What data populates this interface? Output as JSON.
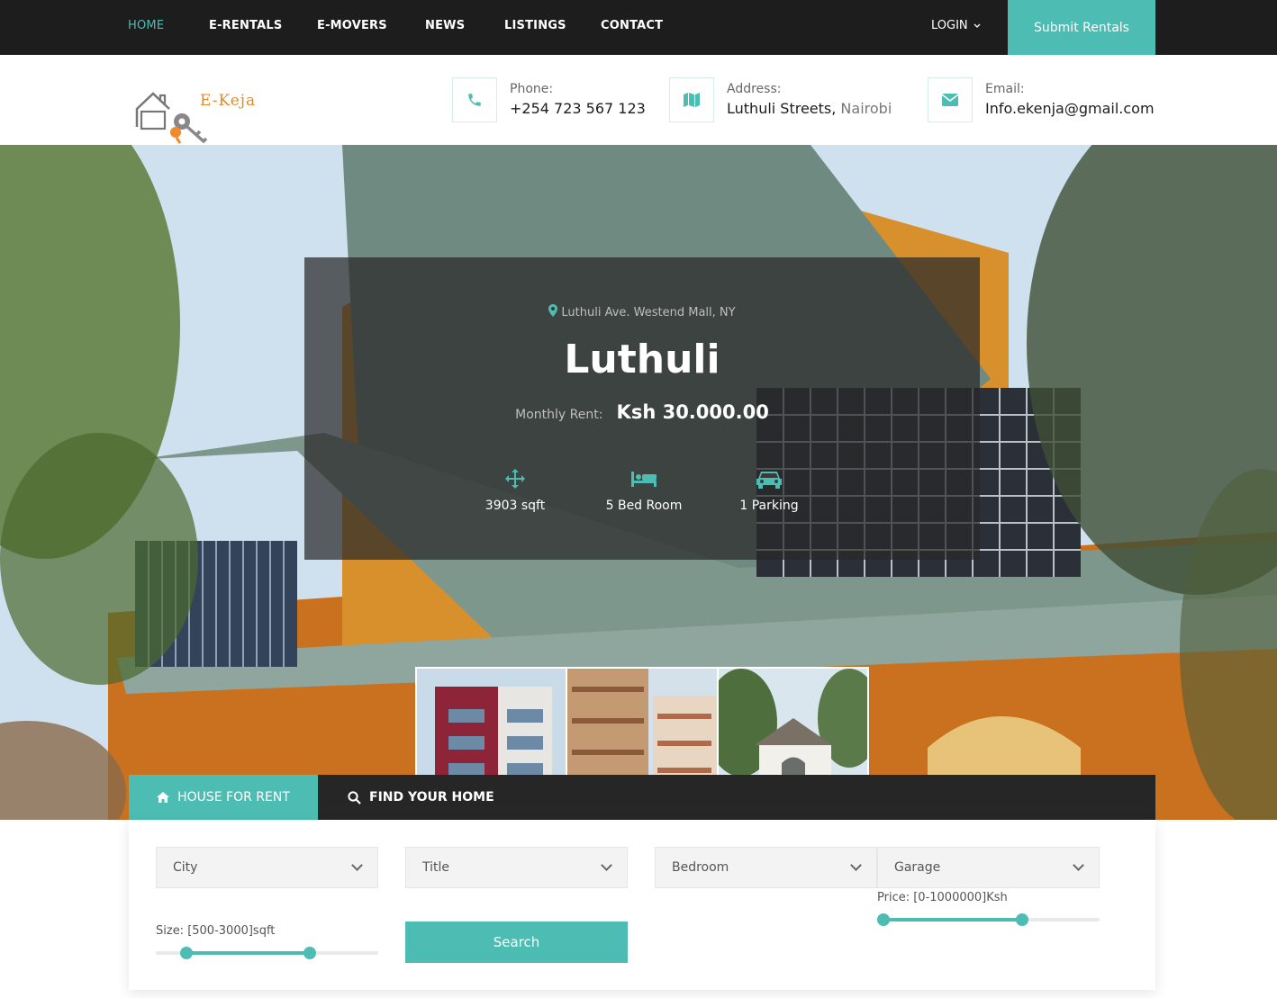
{
  "nav": {
    "items": [
      "HOME",
      "E-RENTALS",
      "E-MOVERS",
      "NEWS",
      "LISTINGS",
      "CONTACT"
    ],
    "login": "LOGIN",
    "submit": "Submit Rentals"
  },
  "header": {
    "logo_text": "E-Keja",
    "phone_label": "Phone:",
    "phone_value": "+254 723 567 123",
    "address_label": "Address:",
    "address_street": "Luthuli Streets,",
    "address_city": " Nairobi",
    "email_label": "Email:",
    "email_value": "Info.ekenja@gmail.com"
  },
  "hero": {
    "location": "Luthuli Ave. Westend Mall, NY",
    "title": "Luthuli",
    "rent_label": "Monthly Rent:",
    "rent_value": "Ksh 30.000.00",
    "features": [
      "3903 sqft",
      "5 Bed Room",
      "1 Parking"
    ]
  },
  "search": {
    "tab_rent": "HOUSE FOR RENT",
    "tab_find": "FIND YOUR HOME",
    "city": "City",
    "title": "Title",
    "bedroom": "Bedroom",
    "garage": "Garage",
    "price_label": "Price: [0-1000000]Ksh",
    "size_label": "Size: [500-3000]sqft",
    "search_button": "Search"
  },
  "colors": {
    "accent": "#4dbdb4",
    "dark": "#1d1d1d"
  }
}
